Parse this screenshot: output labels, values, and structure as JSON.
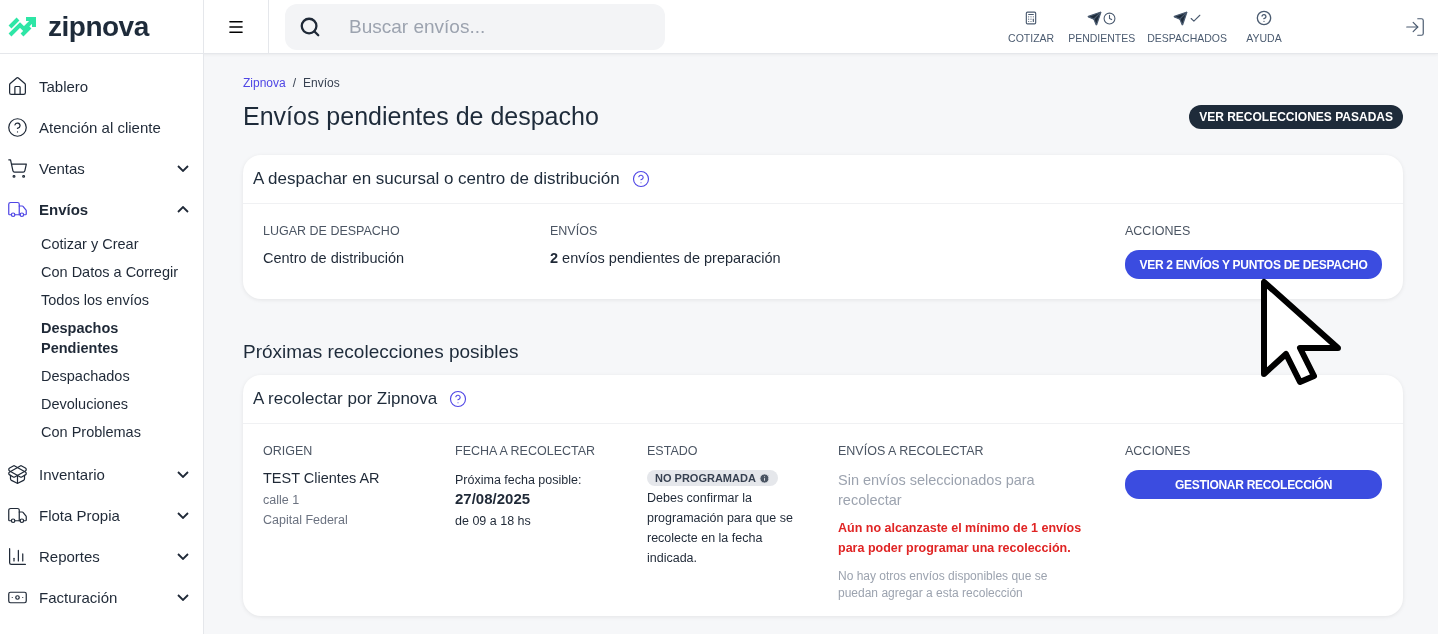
{
  "header": {
    "logo": "zipnova",
    "search": {
      "placeholder": "Buscar envíos..."
    },
    "actions": [
      {
        "label": "COTIZAR",
        "kind": "calculator"
      },
      {
        "label": "PENDIENTES",
        "kind": "pending"
      },
      {
        "label": "DESPACHADOS",
        "kind": "dispatched"
      },
      {
        "label": "AYUDA",
        "kind": "help"
      }
    ]
  },
  "sidebar": {
    "items": [
      {
        "label": "Tablero",
        "selected": false
      },
      {
        "label": "Atención al cliente",
        "selected": false
      },
      {
        "label": "Ventas",
        "selected": false,
        "expanded": false
      },
      {
        "label": "Envíos",
        "selected": true,
        "expanded": true,
        "children": [
          {
            "label": "Cotizar y Crear",
            "selected": false
          },
          {
            "label": "Con Datos a Corregir",
            "selected": false
          },
          {
            "label": "Todos los envíos",
            "selected": false
          },
          {
            "label": "Despachos Pendientes",
            "selected": true
          },
          {
            "label": "Despachados",
            "selected": false
          },
          {
            "label": "Devoluciones",
            "selected": false
          },
          {
            "label": "Con Problemas",
            "selected": false
          }
        ]
      },
      {
        "label": "Inventario",
        "selected": false,
        "expanded": false
      },
      {
        "label": "Flota Propia",
        "selected": false,
        "expanded": false
      },
      {
        "label": "Reportes",
        "selected": false,
        "expanded": false
      },
      {
        "label": "Facturación",
        "selected": false,
        "expanded": false
      }
    ]
  },
  "breadcrumb_separator": "/",
  "breadcrumb": [
    {
      "label": "Zipnova",
      "kind": "link"
    },
    {
      "label": "Envíos",
      "kind": "current"
    }
  ],
  "title": "Envíos pendientes de despacho",
  "past_button": "VER RECOLECCIONES PASADAS",
  "dispatch_card": {
    "title": "A despachar en sucursal o centro de distribución",
    "columns": [
      "LUGAR DE DESPACHO",
      "ENVÍOS",
      "ACCIONES"
    ],
    "place": "Centro de distribución",
    "shipments": "**2** envíos pendientes de preparación",
    "button": "VER 2 ENVÍOS Y PUNTOS DE DESPACHO"
  },
  "section_title": "Próximas recolecciones posibles",
  "pickup_card": {
    "title": "A recolectar por Zipnova",
    "columns": [
      "ORIGEN",
      "FECHA A RECOLECTAR",
      "ESTADO",
      "ENVÍOS A RECOLECTAR",
      "ACCIONES"
    ],
    "origin": {
      "name": "TEST Clientes AR",
      "line1": "calle 1",
      "line2": "Capital Federal"
    },
    "date": {
      "label": "Próxima fecha posible:",
      "value": "27/08/2025",
      "hours": "de 09 a 18 hs"
    },
    "status": {
      "badge": "NO PROGRAMADA",
      "description": "Debes confirmar la programación para que se recolecte en la fecha indicada."
    },
    "shipments": {
      "empty": "Sin envíos seleccionados para recolectar",
      "warning": "Aún no alcanzaste el mínimo de 1 envíos para poder programar una recolección.",
      "note": "No hay otros envíos disponibles que se puedan agregar a esta recolección"
    },
    "button": "GESTIONAR RECOLECCIÓN"
  }
}
